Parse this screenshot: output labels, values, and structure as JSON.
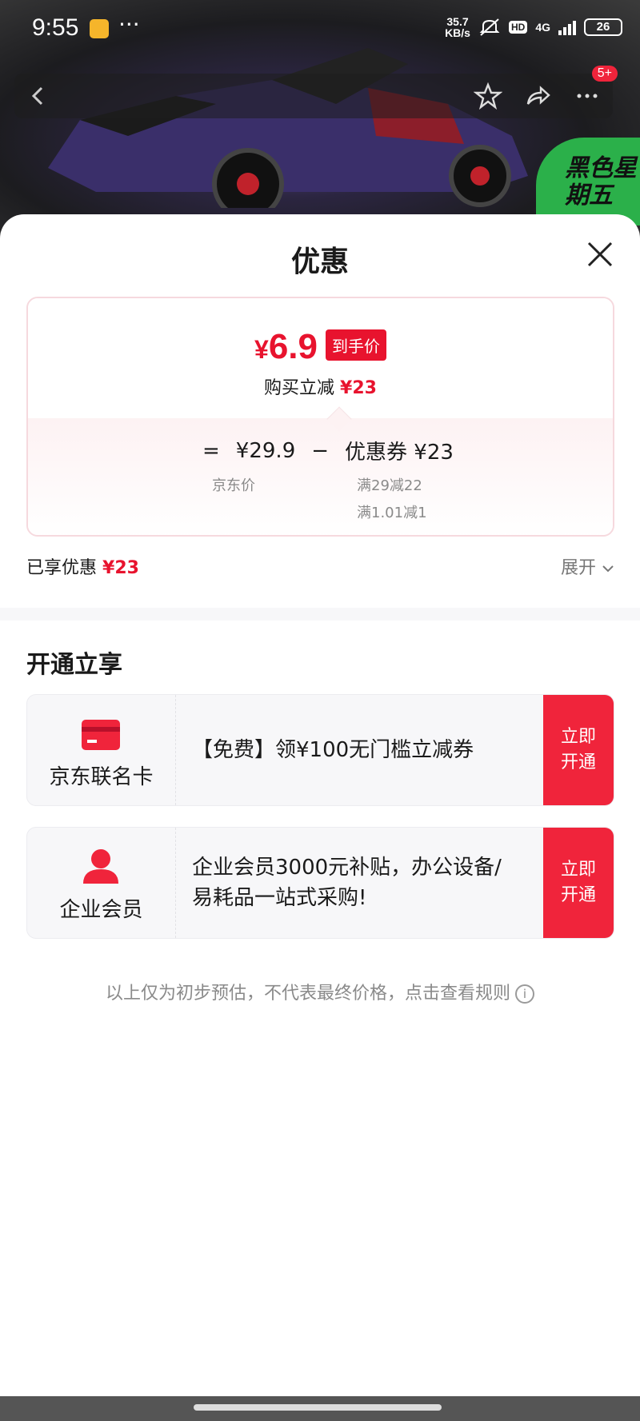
{
  "status_bar": {
    "time": "9:55",
    "more": "···",
    "net_speed_value": "35.7",
    "net_speed_unit": "KB/s",
    "hd": "HD",
    "network": "4G",
    "battery": "26"
  },
  "nav": {
    "badge": "5+"
  },
  "promo": {
    "text": "黑色星期五"
  },
  "sheet": {
    "title": "优惠"
  },
  "price_card": {
    "final_price_yen": "¥",
    "final_price_value": "6.9",
    "final_tag": "到手价",
    "reduce_label": "购买立减",
    "reduce_value": "¥23",
    "eq_sign": "=",
    "jd_price": "¥29.9",
    "minus_sign": "−",
    "coupon_label": "优惠券 ¥23",
    "jd_price_label": "京东价",
    "coupon_rule_1": "满29减22",
    "coupon_rule_2": "满1.01减1"
  },
  "enjoyed": {
    "label": "已享优惠",
    "value": "¥23",
    "expand": "展开"
  },
  "section": {
    "title": "开通立享"
  },
  "offers": [
    {
      "name": "京东联名卡",
      "icon": "card-icon",
      "text": "【免费】领¥100无门槛立减券",
      "button": "立即开通"
    },
    {
      "name": "企业会员",
      "icon": "user-icon",
      "text": "企业会员3000元补贴，办公设备/易耗品一站式采购!",
      "button": "立即开通"
    }
  ],
  "disclaimer": "以上仅为初步预估，不代表最终价格，点击查看规则",
  "colors": {
    "accent": "#e8132e",
    "button": "#f0243b"
  }
}
